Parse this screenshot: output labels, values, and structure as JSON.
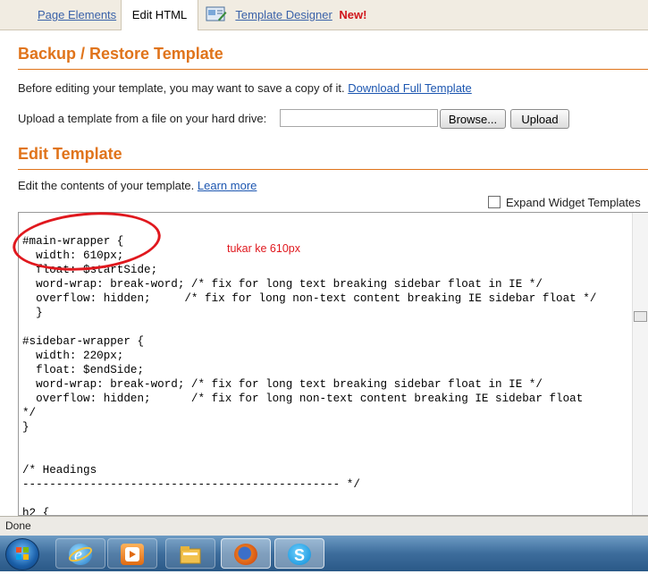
{
  "tabs": {
    "page_elements": "Page Elements",
    "edit_html": "Edit HTML",
    "template_designer": "Template Designer",
    "new_badge": "New!"
  },
  "backup": {
    "heading": "Backup / Restore Template",
    "intro_text": "Before editing your template, you may want to save a copy of it.",
    "download_link": "Download Full Template",
    "upload_text": "Upload a template from a file on your hard drive:",
    "upload_value": "",
    "browse_label": "Browse...",
    "upload_label": "Upload"
  },
  "edit": {
    "heading": "Edit Template",
    "description": "Edit the contents of your template.",
    "learn_more": "Learn more",
    "expand_label": "Expand Widget Templates",
    "expand_checked": false,
    "code": "#main-wrapper {\n  width: 610px;\n  float: $startSide;\n  word-wrap: break-word; /* fix for long text breaking sidebar float in IE */\n  overflow: hidden;     /* fix for long non-text content breaking IE sidebar float */\n  }\n\n#sidebar-wrapper {\n  width: 220px;\n  float: $endSide;\n  word-wrap: break-word; /* fix for long text breaking sidebar float in IE */\n  overflow: hidden;      /* fix for long non-text content breaking IE sidebar float\n*/\n}\n\n\n/* Headings\n----------------------------------------------- */\n\nh2 {",
    "annotation": "tukar ke 610px"
  },
  "status": {
    "text": "Done"
  },
  "taskbar": {
    "items": [
      "start-orb",
      "internet-explorer-icon",
      "media-player-icon",
      "file-explorer-icon",
      "firefox-icon",
      "skype-icon"
    ]
  },
  "colors": {
    "heading": "#e0741b",
    "link": "#1c56b0",
    "annotation": "#e0181e",
    "new_badge": "#d0151b"
  }
}
